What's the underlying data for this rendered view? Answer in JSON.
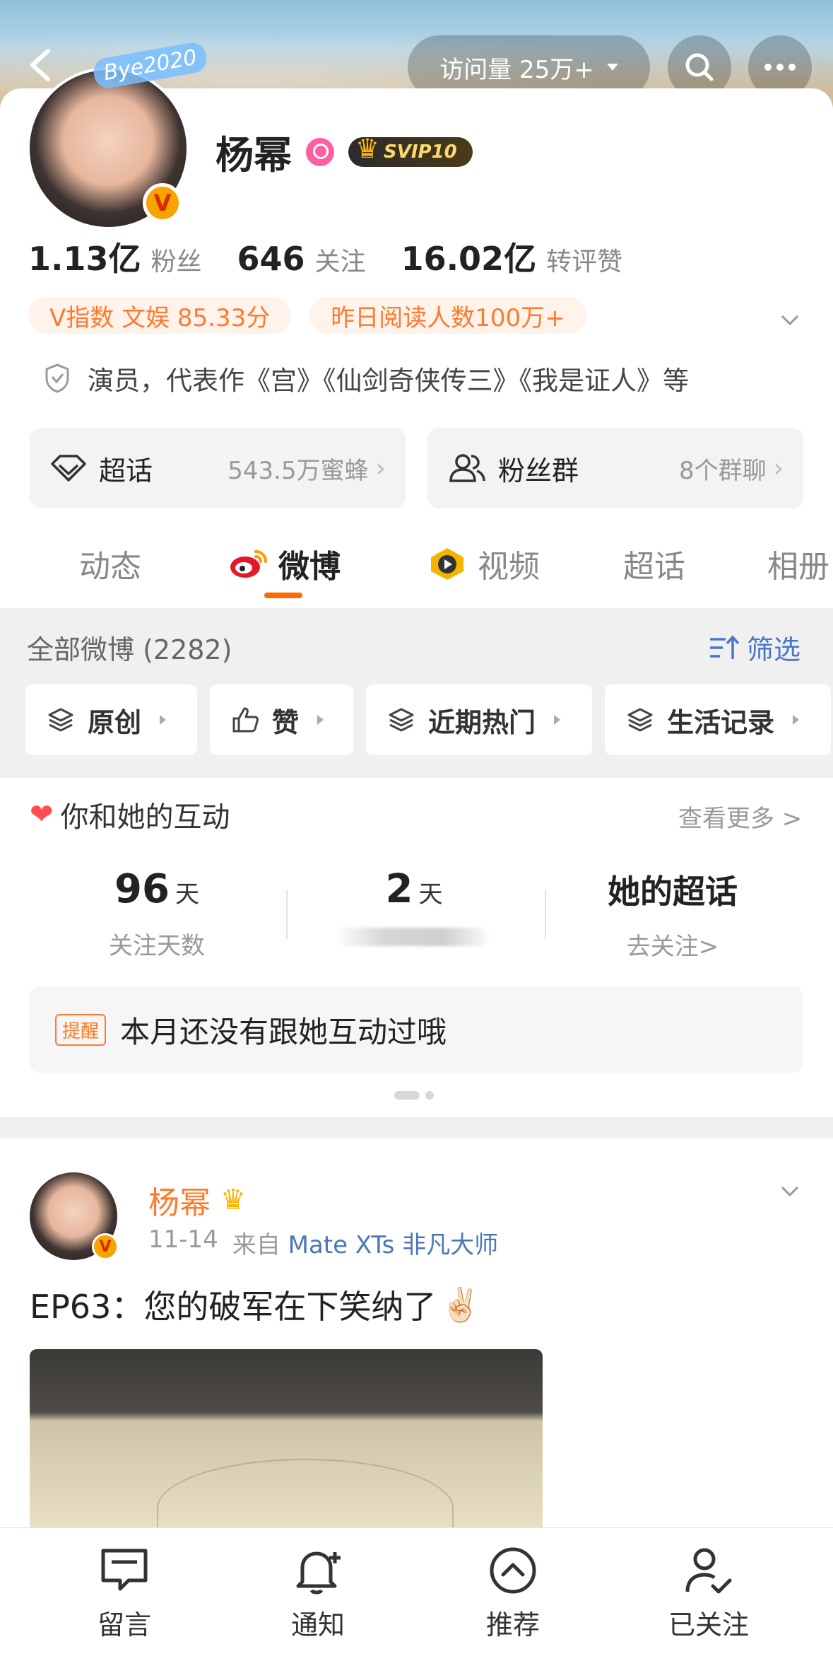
{
  "header": {
    "visits_label": "访问量 25万+"
  },
  "profile": {
    "name": "杨幂",
    "avatar_tag": "Bye2020",
    "verified_badge": "V",
    "svip": "SVIP10",
    "stats": [
      {
        "num": "1.13亿",
        "label": "粉丝"
      },
      {
        "num": "646",
        "label": "关注"
      },
      {
        "num": "16.02亿",
        "label": "转评赞"
      }
    ],
    "chips": [
      "V指数 文娱 85.33分",
      "昨日阅读人数100万+"
    ],
    "bio": "演员，代表作《宫》《仙剑奇侠传三》《我是证人》等"
  },
  "entries": [
    {
      "title": "超话",
      "sub": "543.5万蜜蜂"
    },
    {
      "title": "粉丝群",
      "sub": "8个群聊"
    }
  ],
  "tabs": [
    "动态",
    "微博",
    "视频",
    "超话",
    "相册"
  ],
  "feed_filter": {
    "all_label": "全部微博 (2282)",
    "filter_label": "筛选",
    "buttons": [
      "原创",
      "赞",
      "近期热门",
      "生活记录"
    ]
  },
  "interaction": {
    "title": "你和她的互动",
    "see_more": "查看更多 >",
    "follow_days": {
      "num": "96",
      "unit": "天",
      "label": "关注天数"
    },
    "second": {
      "num": "2",
      "unit": "天"
    },
    "super_topic": {
      "title": "她的超话",
      "sub": "去关注>"
    },
    "reminder_tag": "提醒",
    "reminder_text": "本月还没有跟她互动过哦"
  },
  "post": {
    "name": "杨幂",
    "time": "11-14",
    "from_label": "来自",
    "source": "Mate XTs 非凡大师",
    "text": "EP63：您的破军在下笑纳了",
    "emoji": "✌🏻"
  },
  "bottom_nav": [
    "留言",
    "通知",
    "推荐",
    "已关注"
  ],
  "colors": {
    "accent_orange": "#ff7a2c",
    "link_blue": "#4a76c8",
    "tab_underline": "#ff6a00"
  }
}
